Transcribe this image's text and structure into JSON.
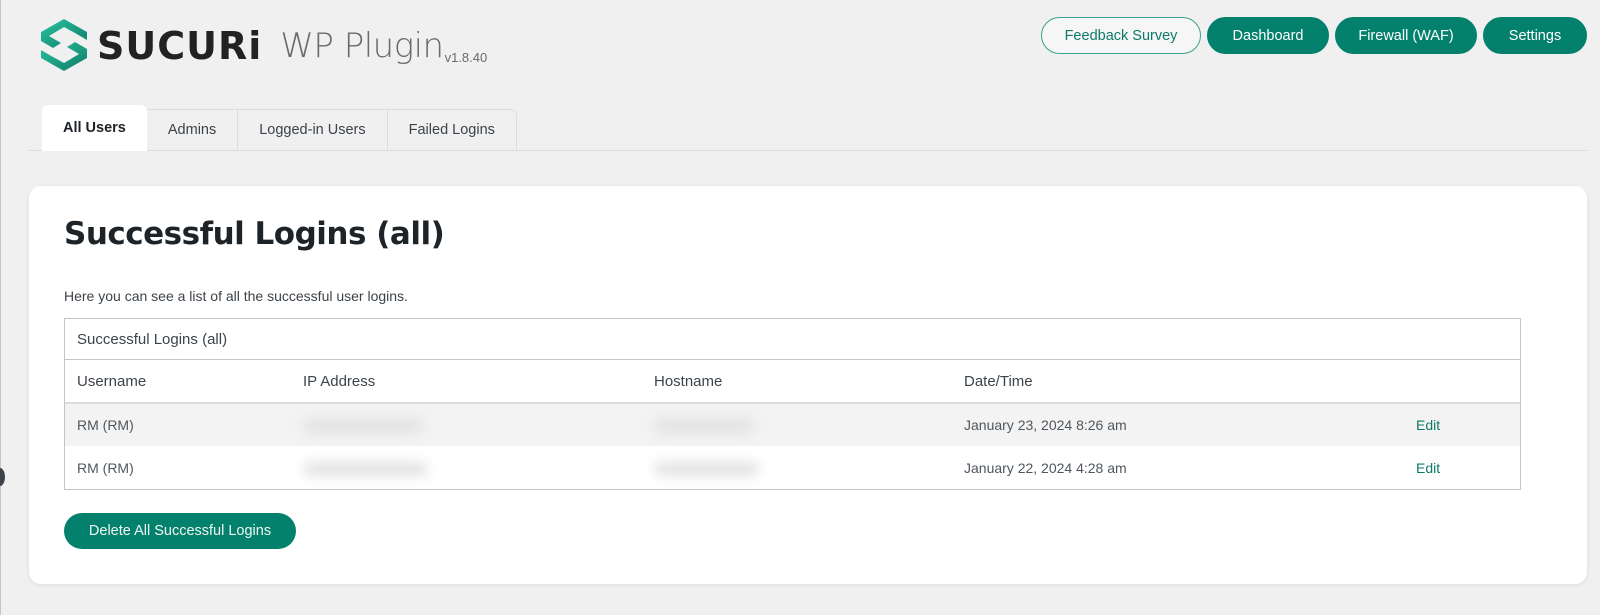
{
  "brand": {
    "name": "SUCURi",
    "product": "WP Plugin",
    "version": "v1.8.40",
    "logo_icon": "sucuri-hexagon-logo",
    "accent_color": "#04816c",
    "logo_gradient": [
      "#2bc4a0",
      "#0f7a67"
    ]
  },
  "top_nav": {
    "feedback_label": "Feedback Survey",
    "dashboard_label": "Dashboard",
    "firewall_label": "Firewall (WAF)",
    "settings_label": "Settings"
  },
  "tabs": [
    {
      "label": "All Users",
      "active": true
    },
    {
      "label": "Admins",
      "active": false
    },
    {
      "label": "Logged-in Users",
      "active": false
    },
    {
      "label": "Failed Logins",
      "active": false
    }
  ],
  "panel": {
    "title": "Successful Logins (all)",
    "description": "Here you can see a list of all the successful user logins.",
    "table": {
      "caption": "Successful Logins (all)",
      "columns": [
        "Username",
        "IP Address",
        "Hostname",
        "Date/Time",
        ""
      ],
      "rows": [
        {
          "username": "RM (RM)",
          "ip": "[redacted]",
          "hostname": "[redacted]",
          "datetime": "January 23, 2024 8:26 am",
          "action": "Edit"
        },
        {
          "username": "RM (RM)",
          "ip": "[redacted]",
          "hostname": "[redacted]",
          "datetime": "January 22, 2024 4:28 am",
          "action": "Edit"
        }
      ]
    },
    "delete_label": "Delete All Successful Logins"
  }
}
